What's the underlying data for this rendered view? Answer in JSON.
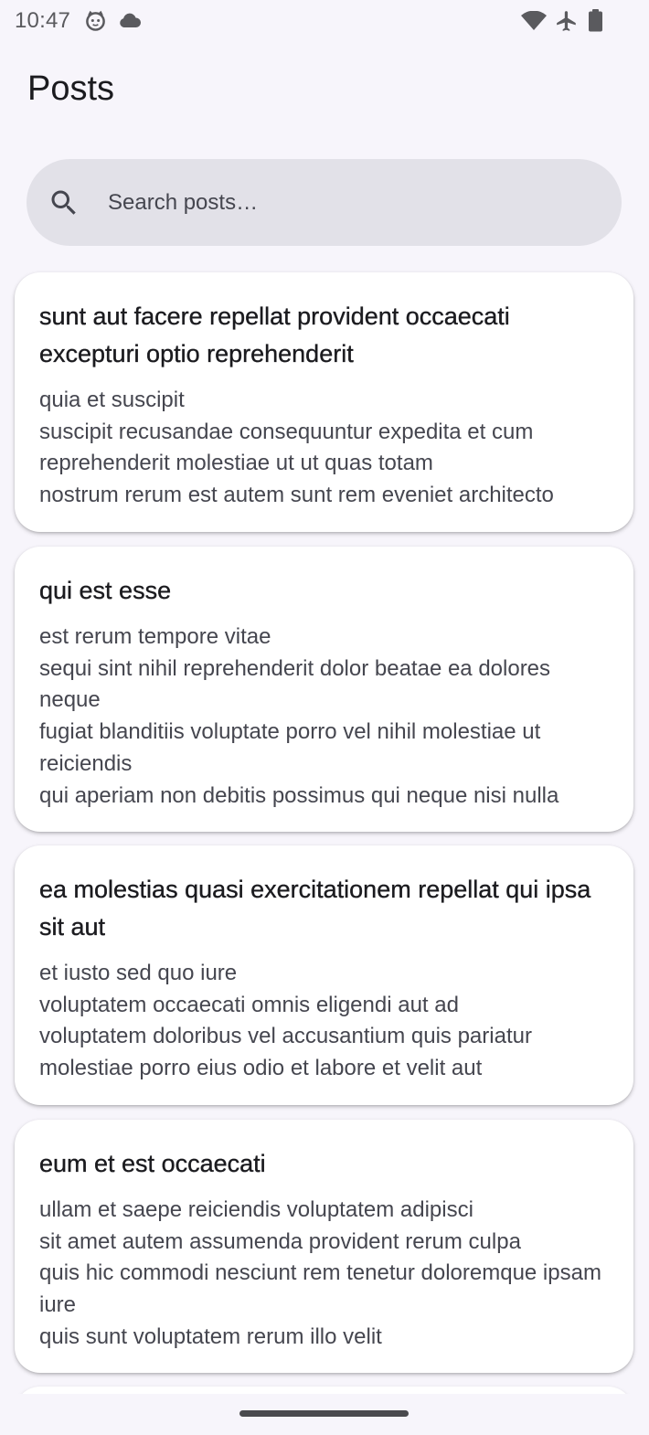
{
  "status_bar": {
    "time": "10:47",
    "icons_left": [
      "cat-face-icon",
      "cloud-icon"
    ],
    "icons_right": [
      "wifi-icon",
      "airplane-mode-icon",
      "battery-icon"
    ]
  },
  "app_bar": {
    "title": "Posts"
  },
  "search": {
    "placeholder": "Search posts…",
    "value": "",
    "icon": "search-icon"
  },
  "posts": [
    {
      "title": "sunt aut facere repellat provident occaecati excepturi optio reprehenderit",
      "body": "quia et suscipit\nsuscipit recusandae consequuntur expedita et cum reprehenderit molestiae ut ut quas totam\nnostrum rerum est autem sunt rem eveniet architecto"
    },
    {
      "title": "qui est esse",
      "body": "est rerum tempore vitae\nsequi sint nihil reprehenderit dolor beatae ea dolores neque\nfugiat blanditiis voluptate porro vel nihil molestiae ut reiciendis\nqui aperiam non debitis possimus qui neque nisi nulla"
    },
    {
      "title": "ea molestias quasi exercitationem repellat qui ipsa sit aut",
      "body": "et iusto sed quo iure\nvoluptatem occaecati omnis eligendi aut ad\nvoluptatem doloribus vel accusantium quis pariatur\nmolestiae porro eius odio et labore et velit aut"
    },
    {
      "title": "eum et est occaecati",
      "body": "ullam et saepe reiciendis voluptatem adipisci\nsit amet autem assumenda provident rerum culpa\nquis hic commodi nesciunt rem tenetur doloremque ipsam iure\nquis sunt voluptatem rerum illo velit"
    }
  ],
  "colors": {
    "background": "#f7f5fb",
    "search_background": "#e2e1e8",
    "card_background": "#ffffff",
    "title_text": "#1b1b1f",
    "body_text": "#45464f"
  }
}
